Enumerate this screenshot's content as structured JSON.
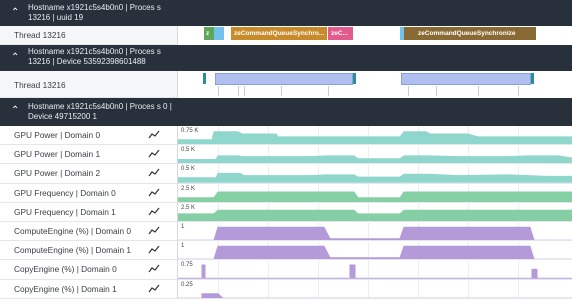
{
  "groups": [
    {
      "title": "Hostname x1921c5s4b0n0 | Proces s 13216 | uuid 19",
      "expanded": true
    },
    {
      "title": "Hostname x1921c5s4b0n0 | Proces s 13216 | Device 53592398601488",
      "expanded": true
    },
    {
      "title": "Hostname x1921c5s4b0n0 | Proces s 0 | Device 49715200 1",
      "expanded": true
    }
  ],
  "threads": [
    {
      "label": "Thread 13216",
      "slices": [
        "z",
        "zeCommandQueueSynchro...",
        "zeC...",
        "zeCommandQueueSynchronize"
      ]
    },
    {
      "label": "Thread 13216"
    }
  ],
  "counters": [
    {
      "label": "GPU Power | Domain 0",
      "scale": "0.75 K",
      "color": "#8fd6cc"
    },
    {
      "label": "GPU Power | Domain 1",
      "scale": "0.5 K",
      "color": "#8fd6cc"
    },
    {
      "label": "GPU Power | Domain 2",
      "scale": "0.5 K",
      "color": "#8fd6cc"
    },
    {
      "label": "GPU Frequency | Domain 0",
      "scale": "2.5 K",
      "color": "#85cfa5"
    },
    {
      "label": "GPU Frequency | Domain 1",
      "scale": "2.5 K",
      "color": "#85cfa5"
    },
    {
      "label": "ComputeEngine (%) | Domain 0",
      "scale": "1",
      "color": "#b59ad9"
    },
    {
      "label": "ComputeEngine (%) | Domain 1",
      "scale": "1",
      "color": "#b59ad9"
    },
    {
      "label": "CopyEngine (%) | Domain 0",
      "scale": "0.75",
      "color": "#b59ad9"
    },
    {
      "label": "CopyEngine (%) | Domain 1",
      "scale": "0.25",
      "color": "#b59ad9"
    }
  ],
  "icons": {
    "expand": "chevron-up-icon",
    "sparkline": "sparkline-icon"
  },
  "colors": {
    "header_bg": "#27303b",
    "slice_green": "#5fa55a",
    "slice_orange": "#c98a2a",
    "slice_pink": "#e35a8c",
    "slice_brown": "#8a6a34",
    "thread_bar": "#aebff0",
    "teal": "#2a8f95"
  }
}
